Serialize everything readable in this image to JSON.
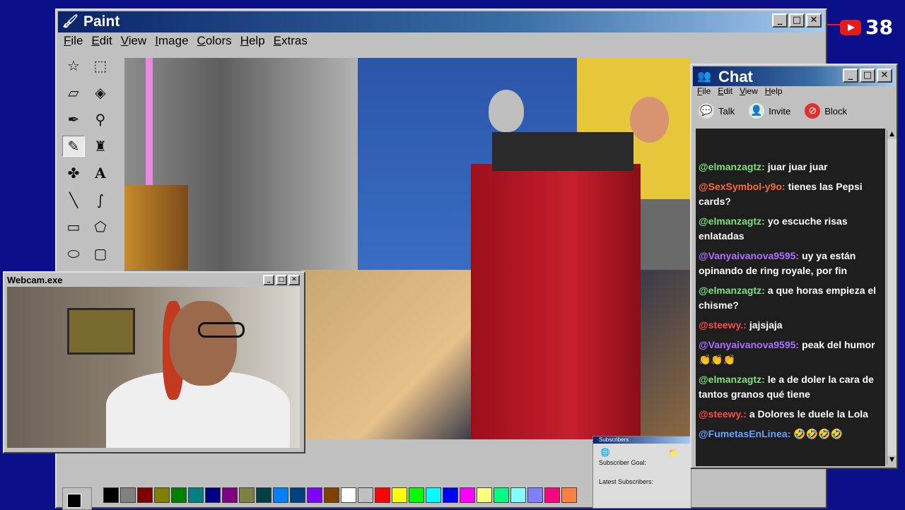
{
  "paint": {
    "title": "Paint",
    "menu": [
      "File",
      "Edit",
      "View",
      "Image",
      "Colors",
      "Help",
      "Extras"
    ],
    "tools": [
      "free-select-icon",
      "rect-select-icon",
      "eraser-icon",
      "fill-icon",
      "picker-icon",
      "magnifier-icon",
      "pencil-icon",
      "brush-icon",
      "airbrush-icon",
      "text-icon",
      "line-icon",
      "curve-icon",
      "rectangle-icon",
      "polygon-icon",
      "ellipse-icon",
      "rounded-rect-icon"
    ],
    "text_tool_glyph": "A",
    "palette": [
      "#000000",
      "#808080",
      "#800000",
      "#808000",
      "#008000",
      "#008080",
      "#000080",
      "#800080",
      "#808040",
      "#004040",
      "#0080ff",
      "#004080",
      "#8000ff",
      "#804000",
      "#ffffff",
      "#c0c0c0",
      "#ff0000",
      "#ffff00",
      "#00ff00",
      "#00ffff",
      "#0000ff",
      "#ff00ff",
      "#ffff80",
      "#00ff80",
      "#80ffff",
      "#8080ff",
      "#ff0080",
      "#ff8040"
    ]
  },
  "chat": {
    "title": "Chat",
    "menu": [
      "File",
      "Edit",
      "View",
      "Help"
    ],
    "toolbar": {
      "talk": "Talk",
      "invite": "Invite",
      "block": "Block"
    },
    "messages": [
      {
        "user": "@elmanzagtz:",
        "text": "juar juar juar",
        "color": "#7ee07e"
      },
      {
        "user": "@SexSymbol-y9o:",
        "text": "tienes las Pepsi cards?",
        "color": "#ff6a3c"
      },
      {
        "user": "@elmanzagtz:",
        "text": "yo escuche risas enlatadas",
        "color": "#7ee07e"
      },
      {
        "user": "@Vanyaivanova9595:",
        "text": "uy ya están opinando de ring royale, por fin",
        "color": "#b070ff"
      },
      {
        "user": "@elmanzagtz:",
        "text": "a que horas empieza el chisme?",
        "color": "#7ee07e"
      },
      {
        "user": "@steewy.:",
        "text": "jajsjaja",
        "color": "#ff4a4a"
      },
      {
        "user": "@Vanyaivanova9595:",
        "text": "peak del humor 👏👏👏",
        "color": "#b070ff"
      },
      {
        "user": "@elmanzagtz:",
        "text": "le a de doler la cara de tantos granos qué tiene",
        "color": "#7ee07e"
      },
      {
        "user": "@steewy.:",
        "text": "a Dolores le duele la Lola",
        "color": "#ff4a4a"
      },
      {
        "user": "@FumetasEnLinea:",
        "text": "🤣🤣🤣🤣",
        "color": "#6aa0ff"
      }
    ]
  },
  "webcam": {
    "title": "Webcam.exe"
  },
  "subscribers": {
    "title": "Subscribers",
    "goal_label": "Subscriber Goal:",
    "latest_label": "Latest Subscribers:"
  },
  "youtube": {
    "count": "38"
  }
}
